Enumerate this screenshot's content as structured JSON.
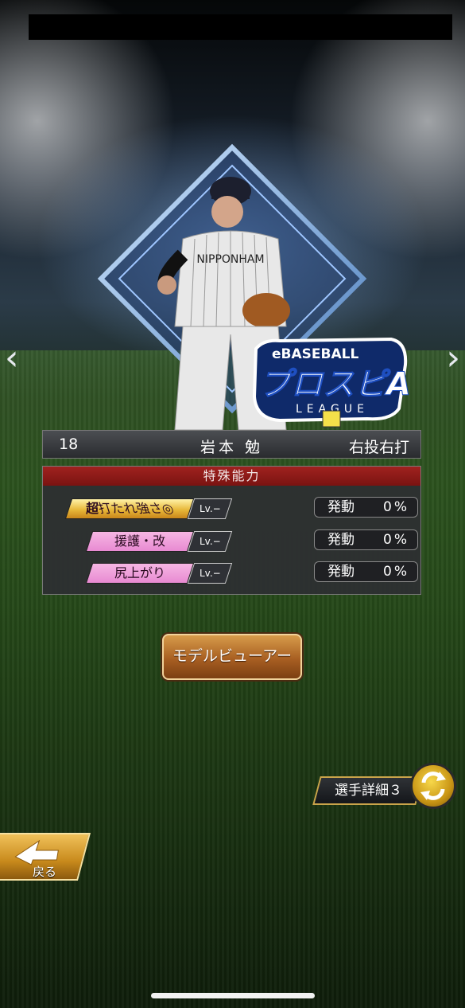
{
  "nav": {
    "prev_glyph": "‹",
    "next_glyph": "›"
  },
  "logo": {
    "line1": "eBASEBALL",
    "line2": "プロスピA",
    "line3": "LEAGUE"
  },
  "player": {
    "number": "18",
    "name": "岩本 勉",
    "handedness": "右投右打",
    "jersey_text": "NIPPONHAM"
  },
  "abilities": {
    "header": "特殊能力",
    "items": [
      {
        "prefix": "超",
        "label": "打たれ強さ◎",
        "lv": "Lv.−",
        "act_label": "発動",
        "act_value": "0%",
        "style": "gold"
      },
      {
        "prefix": "",
        "label": "援護・改",
        "lv": "Lv.−",
        "act_label": "発動",
        "act_value": "0%",
        "style": "pink"
      },
      {
        "prefix": "",
        "label": "尻上がり",
        "lv": "Lv.−",
        "act_label": "発動",
        "act_value": "0%",
        "style": "pink"
      }
    ]
  },
  "buttons": {
    "model_viewer": "モデルビューアー",
    "player_detail": "選手詳細３",
    "back": "戻る"
  },
  "colors": {
    "accent_red": "#9a1c1a",
    "gold": "#e8b93a",
    "pink": "#e88ad2"
  }
}
